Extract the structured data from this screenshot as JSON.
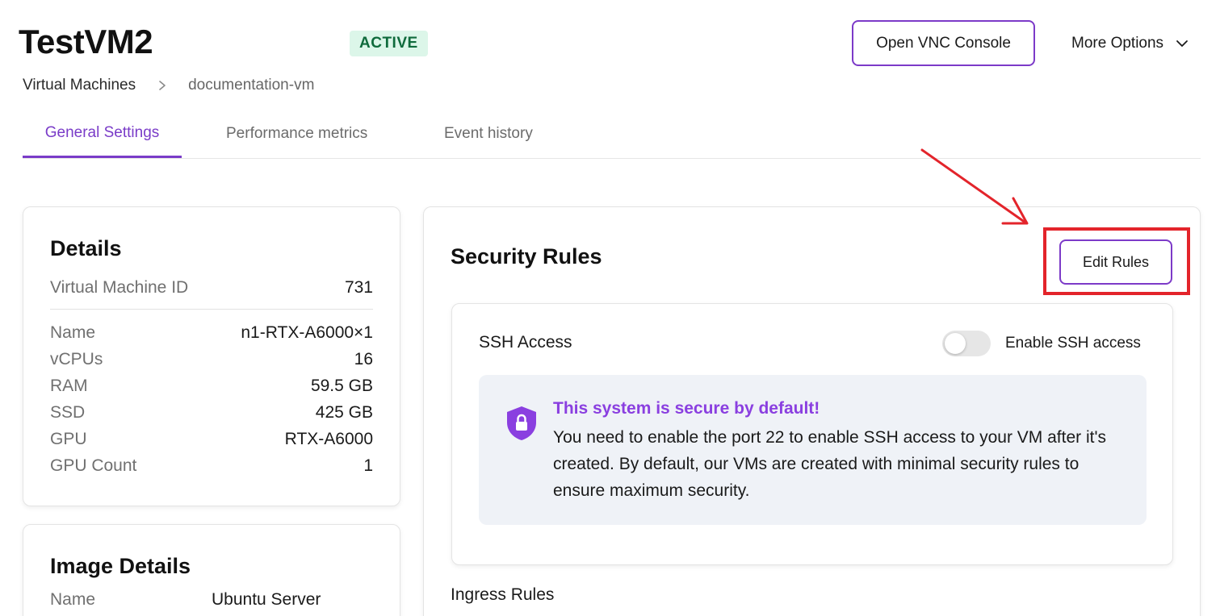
{
  "header": {
    "title": "TestVM2",
    "status": "ACTIVE",
    "vnc_button": "Open VNC Console",
    "more_options": "More Options"
  },
  "breadcrumb": {
    "items": [
      "Virtual Machines",
      "documentation-vm"
    ]
  },
  "tabs": [
    {
      "label": "General Settings",
      "active": true
    },
    {
      "label": "Performance metrics",
      "active": false
    },
    {
      "label": "Event history",
      "active": false
    }
  ],
  "details": {
    "title": "Details",
    "vm_id": {
      "label": "Virtual Machine ID",
      "value": "731"
    },
    "rows": [
      {
        "label": "Name",
        "value": "n1-RTX-A6000×1"
      },
      {
        "label": "vCPUs",
        "value": "16"
      },
      {
        "label": "RAM",
        "value": "59.5 GB"
      },
      {
        "label": "SSD",
        "value": "425 GB"
      },
      {
        "label": "GPU",
        "value": "RTX-A6000"
      },
      {
        "label": "GPU Count",
        "value": "1"
      }
    ]
  },
  "image_details": {
    "title": "Image Details",
    "rows": [
      {
        "label": "Name",
        "value": "Ubuntu Server"
      }
    ]
  },
  "security": {
    "title": "Security Rules",
    "edit_button": "Edit Rules",
    "ssh": {
      "title": "SSH Access",
      "toggle_label": "Enable SSH access",
      "enabled": false
    },
    "info": {
      "heading": "This system is secure by default!",
      "body": "You need to enable the port 22 to enable SSH access to your VM after it's created. By default, our VMs are created with minimal security rules to ensure maximum security."
    },
    "ingress_title": "Ingress Rules"
  },
  "colors": {
    "accent": "#7a3cc8",
    "status_bg": "#dcf6e9",
    "status_text": "#0f6b3c",
    "annotation": "#e3242b",
    "info_bg": "#eff2f7"
  },
  "icons": [
    "chevron-down-icon",
    "chevron-right-icon",
    "shield-lock-icon",
    "annotation-arrow"
  ]
}
